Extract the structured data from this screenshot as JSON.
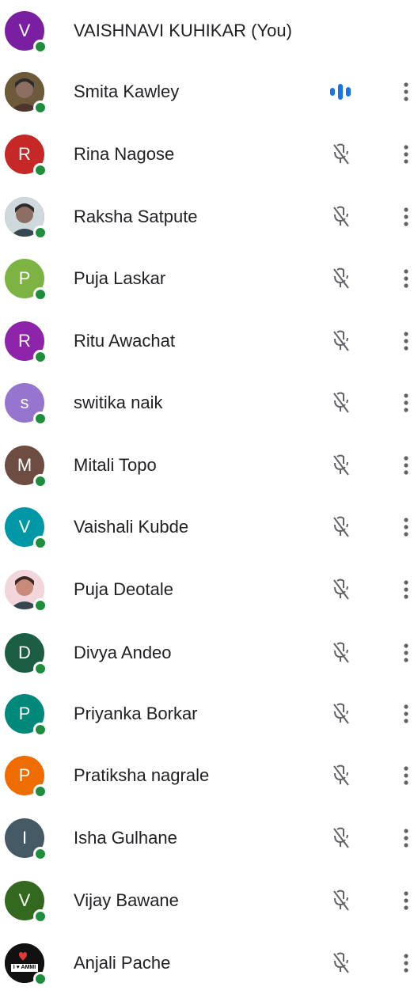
{
  "participants": [
    {
      "name": "VAISHNAVI KUHIKAR (You)",
      "initial": "V",
      "avatar_color": "#7b1fa2",
      "status_icon": "",
      "show_more": false,
      "photo": false
    },
    {
      "name": "Smita Kawley",
      "initial": "",
      "avatar_color": "#5d4037",
      "status_icon": "speaking-icon",
      "show_more": true,
      "photo": true
    },
    {
      "name": "Rina Nagose",
      "initial": "R",
      "avatar_color": "#c62828",
      "status_icon": "mic-off-icon",
      "show_more": true,
      "photo": false
    },
    {
      "name": "Raksha Satpute",
      "initial": "",
      "avatar_color": "#455a64",
      "status_icon": "mic-off-icon",
      "show_more": true,
      "photo": true
    },
    {
      "name": "Puja Laskar",
      "initial": "P",
      "avatar_color": "#7cb342",
      "status_icon": "mic-off-icon",
      "show_more": true,
      "photo": false
    },
    {
      "name": "Ritu Awachat",
      "initial": "R",
      "avatar_color": "#8e24aa",
      "status_icon": "mic-off-icon",
      "show_more": true,
      "photo": false
    },
    {
      "name": "switika naik",
      "initial": "s",
      "avatar_color": "#9575cd",
      "status_icon": "mic-off-icon",
      "show_more": true,
      "photo": false
    },
    {
      "name": "Mitali Topo",
      "initial": "M",
      "avatar_color": "#6d4c41",
      "status_icon": "mic-off-icon",
      "show_more": true,
      "photo": false
    },
    {
      "name": "Vaishali Kubde",
      "initial": "V",
      "avatar_color": "#0097a7",
      "status_icon": "mic-off-icon",
      "show_more": true,
      "photo": false
    },
    {
      "name": "Puja Deotale",
      "initial": "",
      "avatar_color": "#d7a6b3",
      "status_icon": "mic-off-icon",
      "show_more": true,
      "photo": true
    },
    {
      "name": "Divya Andeo",
      "initial": "D",
      "avatar_color": "#1b5e44",
      "status_icon": "mic-off-icon",
      "show_more": true,
      "photo": false
    },
    {
      "name": "Priyanka Borkar",
      "initial": "P",
      "avatar_color": "#00897b",
      "status_icon": "mic-off-icon",
      "show_more": true,
      "photo": false
    },
    {
      "name": "Pratiksha nagrale",
      "initial": "P",
      "avatar_color": "#ef6c00",
      "status_icon": "mic-off-icon",
      "show_more": true,
      "photo": false
    },
    {
      "name": "Isha Gulhane",
      "initial": "I",
      "avatar_color": "#455a64",
      "status_icon": "mic-off-icon",
      "show_more": true,
      "photo": false
    },
    {
      "name": "Vijay Bawane",
      "initial": "V",
      "avatar_color": "#33691e",
      "status_icon": "mic-off-icon",
      "show_more": true,
      "photo": false
    },
    {
      "name": "Anjali Pache",
      "initial": "",
      "avatar_color": "#212121",
      "status_icon": "mic-off-icon",
      "show_more": true,
      "photo": true,
      "photo_text": "I ♥ AMMI"
    }
  ],
  "colors": {
    "presence": "#1e8e3e",
    "speaking": "#1a73e8",
    "icon_gray": "#5f6368"
  }
}
